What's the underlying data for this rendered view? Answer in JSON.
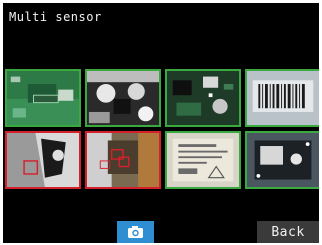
{
  "header": {
    "title": "Multi sensor"
  },
  "colors": {
    "ok_frame": "#3aaa40",
    "ng_frame": "#d4202a",
    "camera_button": "#2f8ed1"
  },
  "sensors": [
    {
      "row": 1,
      "col": 1,
      "status": "OK",
      "scene": "green PCB with chip"
    },
    {
      "row": 1,
      "col": 2,
      "status": "OK",
      "scene": "metal parts"
    },
    {
      "row": 1,
      "col": 3,
      "status": "OK",
      "scene": "circuit board"
    },
    {
      "row": 1,
      "col": 4,
      "status": "OK",
      "scene": "barcode label"
    },
    {
      "row": 2,
      "col": 1,
      "status": "NG",
      "scene": "white mark with inspection window"
    },
    {
      "row": 2,
      "col": 2,
      "status": "NG",
      "scene": "connector with inspection windows"
    },
    {
      "row": 2,
      "col": 3,
      "status": "OK",
      "scene": "component label"
    },
    {
      "row": 2,
      "col": 4,
      "status": "OK",
      "scene": "dark PCB module"
    }
  ],
  "footer": {
    "camera_icon": "camera-icon",
    "back_label": "Back"
  }
}
